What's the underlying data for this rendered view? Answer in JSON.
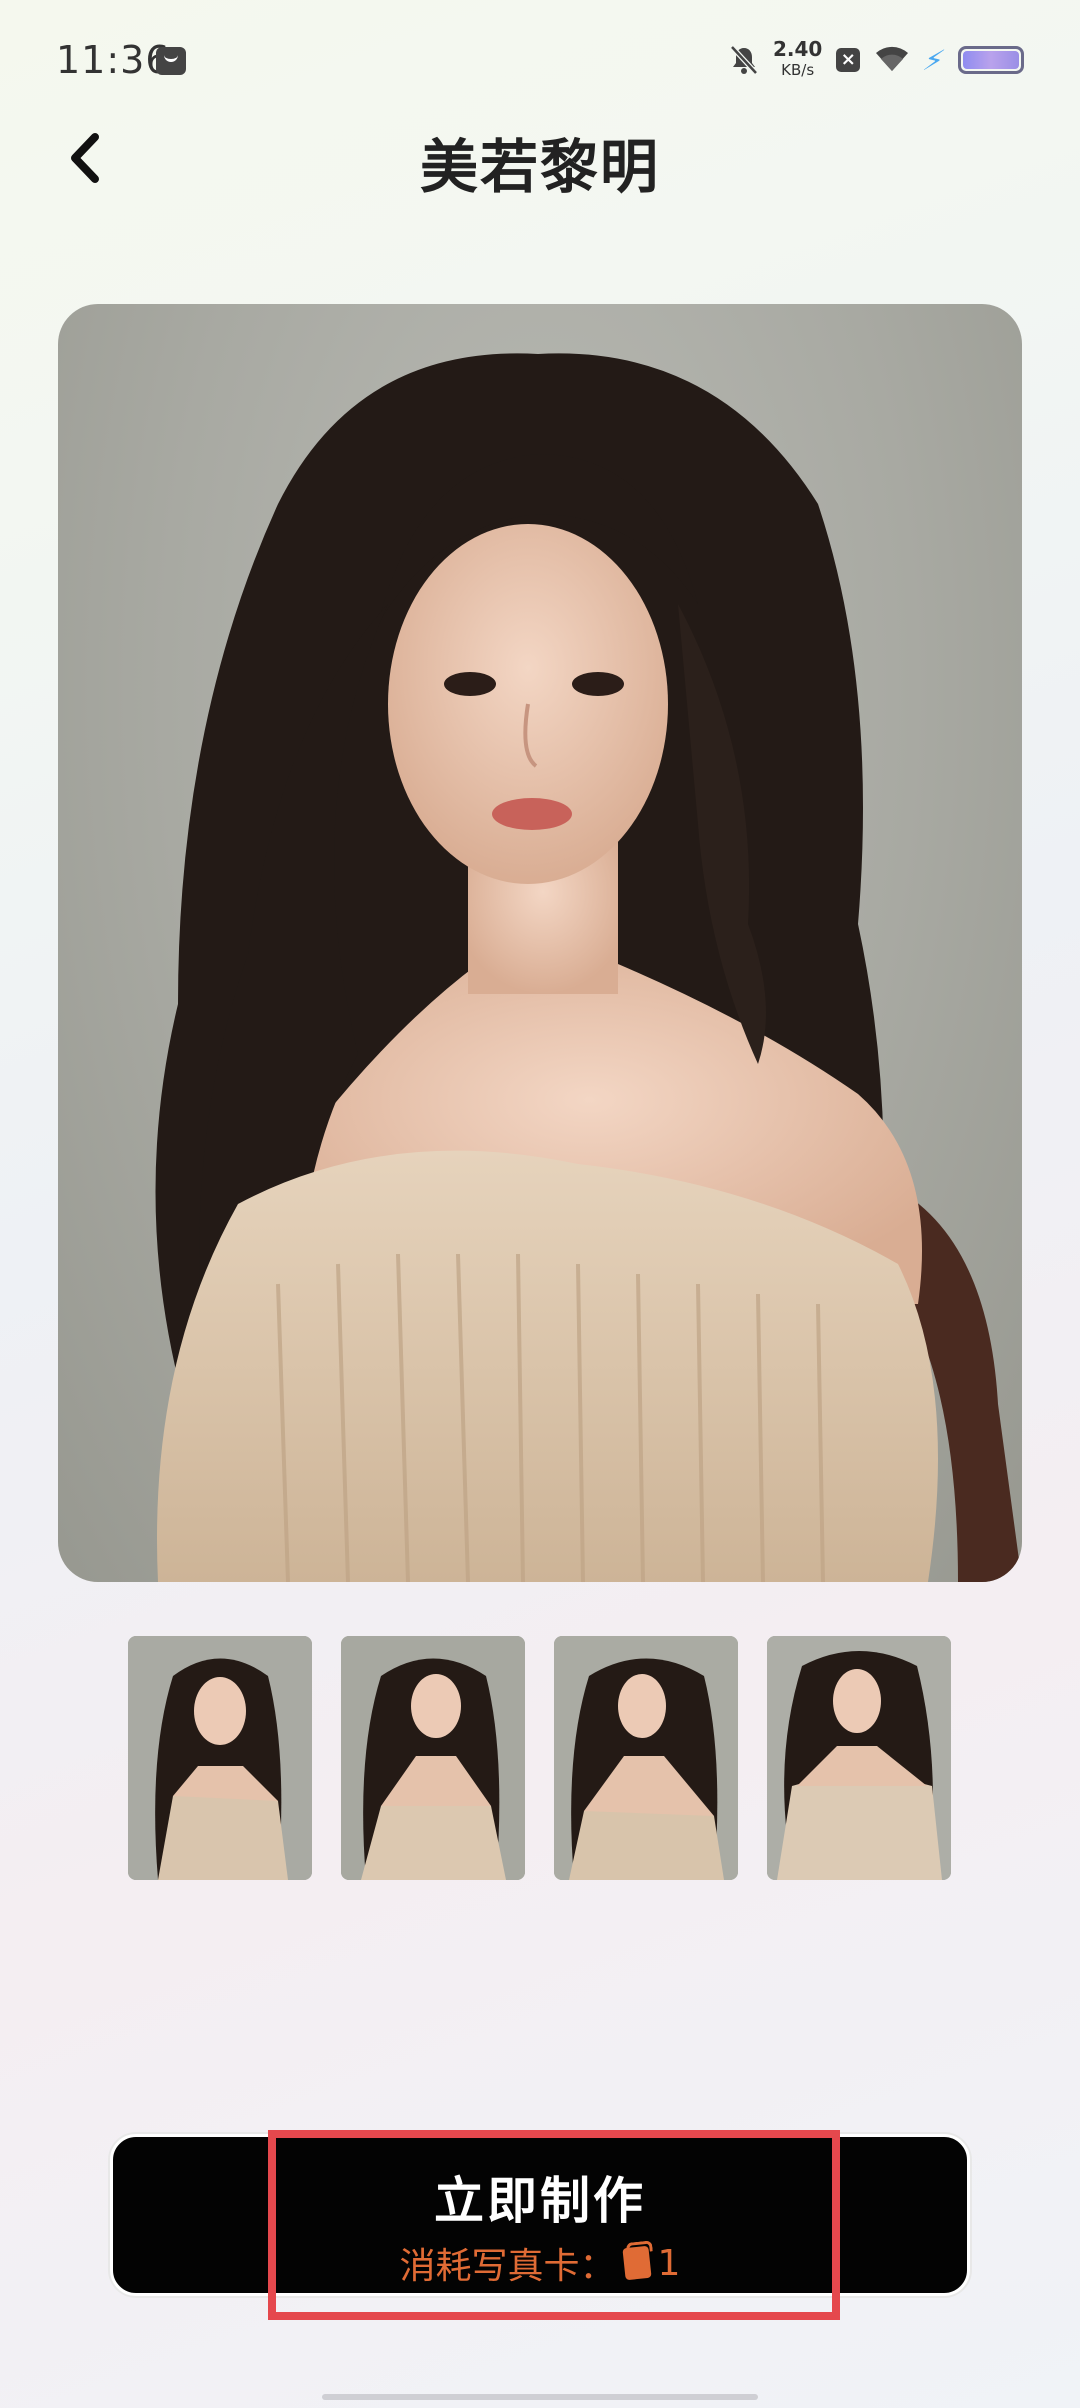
{
  "status_bar": {
    "time": "11:36",
    "net_speed_value": "2.40",
    "net_speed_unit": "KB/s",
    "icons": [
      "notification-app-icon",
      "bell-muted-icon",
      "box-x-icon",
      "wifi-icon",
      "charging-icon",
      "battery-icon"
    ]
  },
  "header": {
    "title": "美若黎明",
    "back_icon": "chevron-left-icon"
  },
  "thumbnails": {
    "count": 4
  },
  "action": {
    "label": "立即制作",
    "cost_label": "消耗写真卡：",
    "cost_value": "1",
    "cost_icon": "photo-card-icon",
    "cost_color": "#e06b35"
  },
  "colors": {
    "button_bg": "#030303",
    "highlight": "#e5484d"
  }
}
